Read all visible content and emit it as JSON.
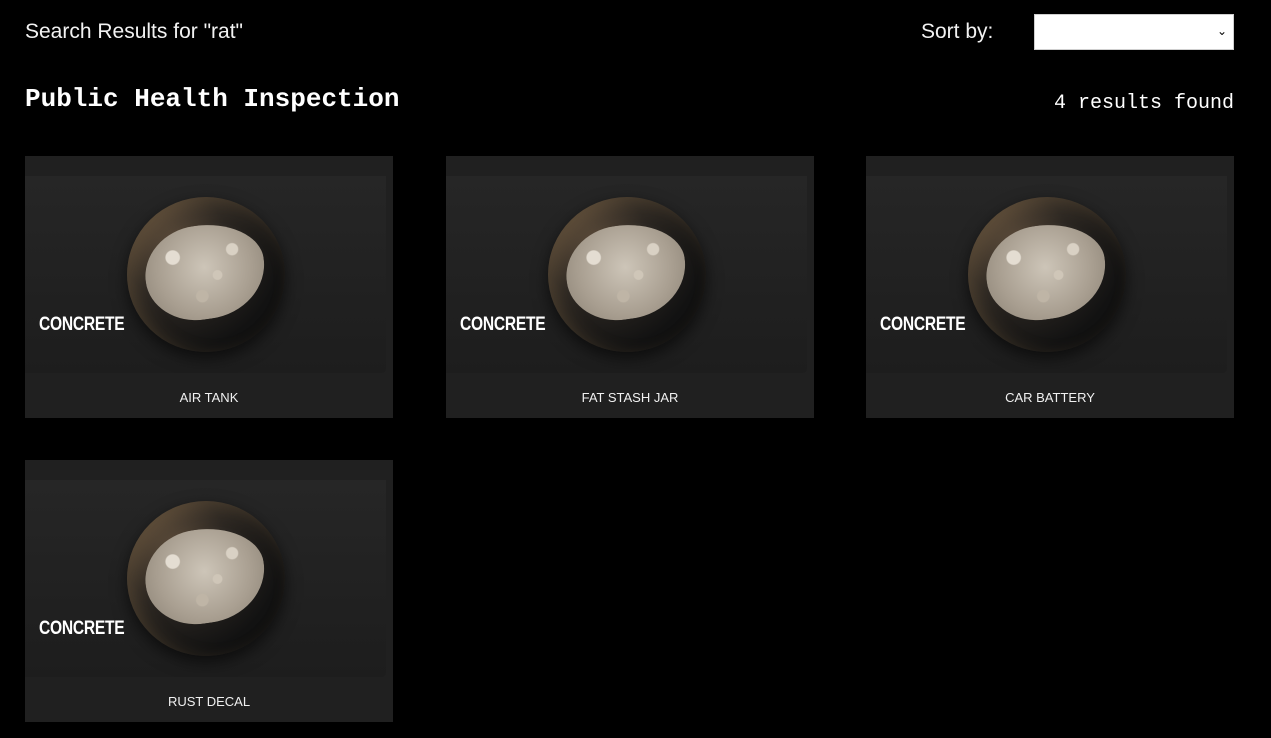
{
  "header": {
    "search_title": "Search Results for \"rat\"",
    "sort_label": "Sort by:",
    "sort_value": ""
  },
  "section": {
    "title": "Public Health Inspection",
    "result_count": "4 results found"
  },
  "results": [
    {
      "material": "CONCRETE",
      "name": "AIR TANK"
    },
    {
      "material": "CONCRETE",
      "name": "FAT STASH JAR"
    },
    {
      "material": "CONCRETE",
      "name": "CAR BATTERY"
    },
    {
      "material": "CONCRETE",
      "name": "RUST DECAL"
    }
  ],
  "icons": {
    "sort_chevron": "chevron-down-icon"
  }
}
